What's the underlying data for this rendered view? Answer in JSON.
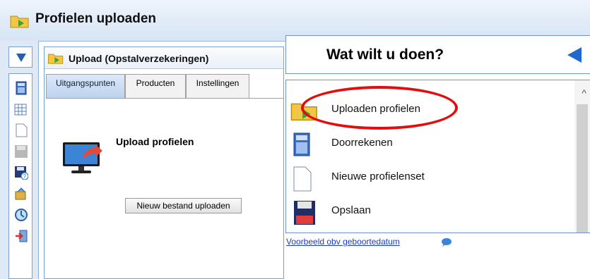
{
  "app": {
    "title": "Profielen uploaden"
  },
  "upload_panel": {
    "header": "Upload (Opstalverzekeringen)",
    "tabs": [
      "Uitgangspunten",
      "Producten",
      "Instellingen"
    ],
    "section_title": "Upload profielen",
    "upload_button_label": "Nieuw bestand uploaden"
  },
  "popup": {
    "title": "Wat wilt u doen?",
    "items": [
      {
        "label": "Uploaden profielen",
        "icon": "folder-upload-icon"
      },
      {
        "label": "Doorrekenen",
        "icon": "calculator-icon"
      },
      {
        "label": "Nieuwe profielenset",
        "icon": "new-document-icon"
      },
      {
        "label": "Opslaan",
        "icon": "floppy-disk-icon"
      }
    ],
    "example_link": "Voorbeeld obv geboortedatum"
  },
  "toolbar_icons": [
    "calculator-icon",
    "table-icon",
    "new-document-icon",
    "save-disabled-icon",
    "save-as-icon",
    "export-icon",
    "refresh-icon",
    "exit-icon"
  ],
  "colors": {
    "accent_blue": "#1f68cc",
    "highlight_red": "#e30d0d",
    "panel_border": "#6f94c9",
    "link": "#1a3ad0"
  }
}
